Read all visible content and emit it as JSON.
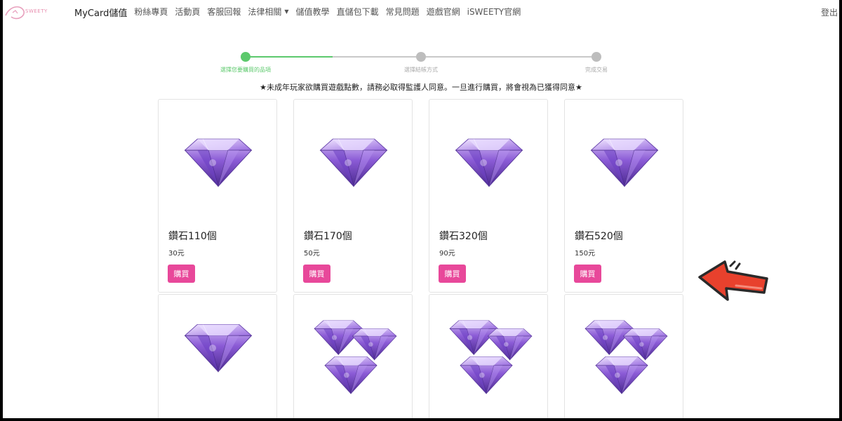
{
  "nav": {
    "logo_text": "SWEETY",
    "items": [
      "MyCard儲值",
      "粉絲專頁",
      "活動頁",
      "客服回報",
      "法律相關",
      "儲值教學",
      "直儲包下載",
      "常見問題",
      "遊戲官網",
      "iSWEETY官網"
    ],
    "logout": "登出"
  },
  "stepper": {
    "steps": [
      "選擇您要購買的品項",
      "選擇結帳方式",
      "完成交易"
    ],
    "current_step": 1
  },
  "notice": "★未成年玩家欲購買遊戲點數，請務必取得監護人同意。一旦進行購買，將會視為已獲得同意★",
  "products": [
    {
      "name": "鑽石110個",
      "price": "30元",
      "buy": "購買"
    },
    {
      "name": "鑽石170個",
      "price": "50元",
      "buy": "購買"
    },
    {
      "name": "鑽石320個",
      "price": "90元",
      "buy": "購買"
    },
    {
      "name": "鑽石520個",
      "price": "150元",
      "buy": "購買"
    }
  ],
  "colors": {
    "accent_pink": "#e8489a",
    "step_green": "#5cc96c",
    "arrow_red": "#e8412d"
  },
  "icons": [
    "diamond-gem-icon",
    "diamond-cluster-icon",
    "pointer-arrow-icon"
  ]
}
